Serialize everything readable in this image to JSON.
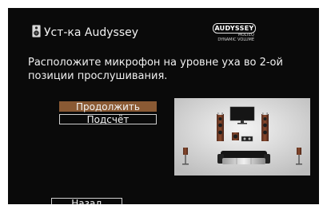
{
  "header": {
    "title": "Уст-ка Audyssey",
    "title_icon": "speaker-icon"
  },
  "logo": {
    "brand": "AUDYSSEY",
    "line1": "MULTEQ",
    "line2": "DYNAMIC VOLUME"
  },
  "message": "Расположите микрофон на уровне уха во 2-ой позиции прослушивания.",
  "menu": {
    "continue_label": "Продолжить",
    "count_label": "Подсчёт",
    "selected": "continue"
  },
  "footer": {
    "back_label": "Назад"
  },
  "colors": {
    "screen_bg": "#0a0a0a",
    "highlight": "#8a5a34",
    "text": "#f0f0f0",
    "diagram_bg": "#d8d8d8"
  }
}
